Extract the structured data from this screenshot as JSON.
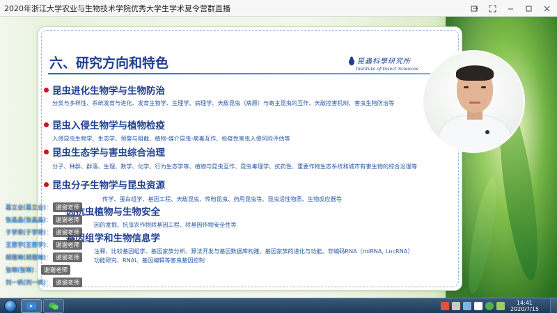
{
  "window": {
    "title": "2020年浙江大学农业与生物技术学院优秀大学生学术夏令营群直播"
  },
  "slide": {
    "title": "六、研究方向和特色",
    "logo": {
      "cn": "昆蟲科學研究所",
      "en": "Institute of Insect Sciences"
    },
    "sections": [
      {
        "heading": "昆虫进化生物学与生物防治",
        "description": "分类与多样性、系统发育与进化、发育生物学、生理学、病理学、天敌昆虫（病原）与寄主昆虫的互作、天敌控害机制、害虫生物防治等"
      },
      {
        "heading": "昆虫入侵生物学与植物检疫",
        "description": "入侵昆虫生物学、生态学、预警与阻截、植物-媒介昆虫-病毒互作、检疫性害虫入侵风险评估等"
      },
      {
        "heading": "昆虫生态学与害虫综合治理",
        "description": "分子、种群、群落、生理、数学、化学、行为生态学等、植物与昆虫互作、昆虫毒理学、抗药性、重要作物生态系统和城市有害生物的综合治理等"
      },
      {
        "heading": "昆虫分子生物学与昆虫资源",
        "description": "传学、蛋白组学、基因工程、天敌昆虫、传粉昆虫、药用昆虫等、昆虫活性物质、生物反应器等"
      },
      {
        "heading": "因抗虫植物与生物安全",
        "description": "因的发掘、抗虫农作物转基因工程、转基因作物安全性等"
      },
      {
        "heading": "基因组学和生物信息学",
        "description": "注释、比较基因组学、基因家族分析、算法开发与基因数据库构建、基因家族的进化与功能、非编码RNA（miRNA, LncRNA）",
        "description2": "功能研究、RNAi、基因编辑等害虫基因控制"
      }
    ]
  },
  "chat": {
    "messages": [
      {
        "name": "葛立业(葛立业)",
        "text": "谢谢老师"
      },
      {
        "name": "张晶晶(张晶晶)",
        "text": "谢谢老师"
      },
      {
        "name": "于学荣(于学荣)",
        "text": "谢谢老师"
      },
      {
        "name": "王思宇(王思宇)",
        "text": "谢谢老师"
      },
      {
        "name": "胡雅琳(胡雅琳)",
        "text": "谢谢老师"
      },
      {
        "name": "张琳(张琳)",
        "text": "谢谢老师"
      },
      {
        "name": "刘一帆(刘一帆)",
        "text": "谢谢老师"
      }
    ]
  },
  "taskbar": {
    "time": "14:41",
    "date": "2020/7/15"
  },
  "colors": {
    "title_blue": "#1f3f8f",
    "desc_blue": "#2a59a8",
    "bullet_red": "#c8161d",
    "chat_name": "#4aa8ff"
  }
}
